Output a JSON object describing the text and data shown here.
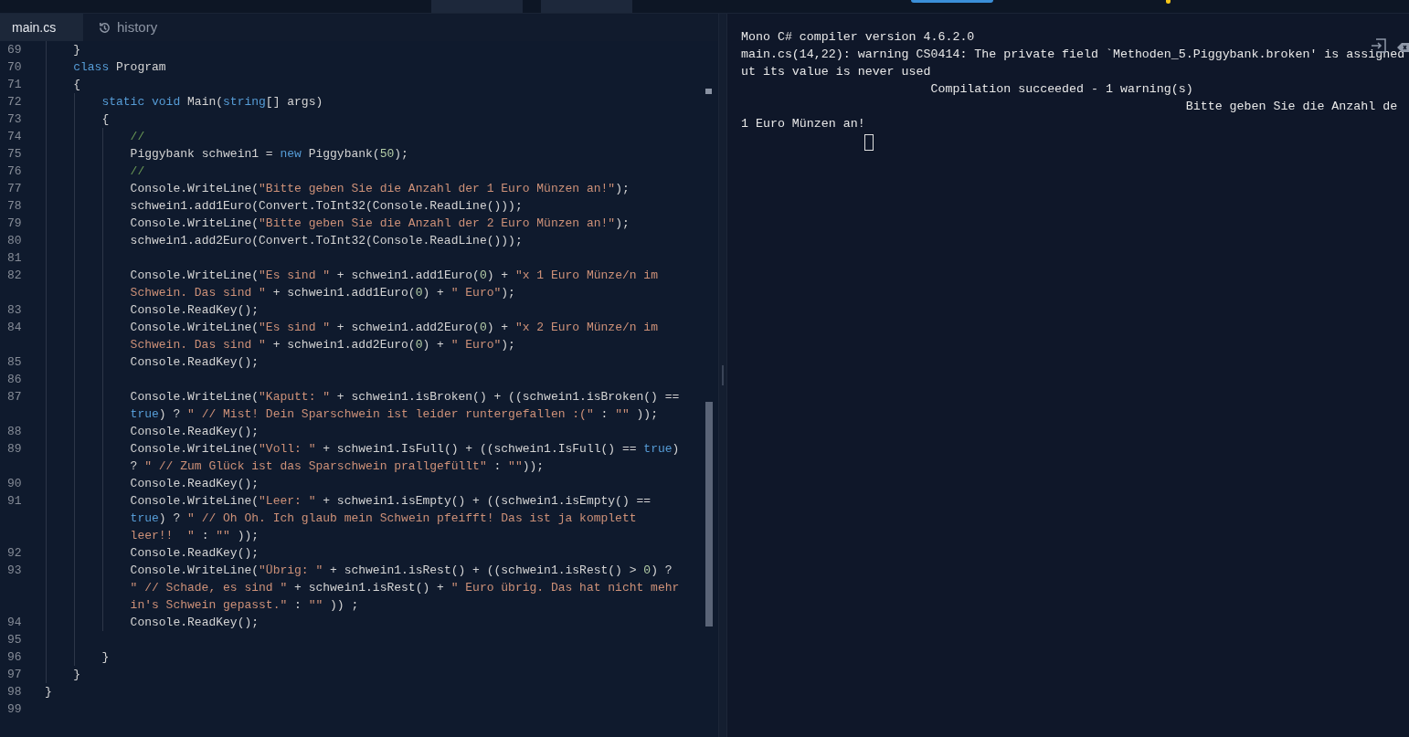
{
  "tabs": [
    {
      "kind": "file",
      "label": "main.cs",
      "selected": true
    },
    {
      "kind": "history",
      "label": "history",
      "selected": false
    }
  ],
  "code_lines": [
    {
      "number": "69",
      "rows": [
        {
          "tokens": [
            {
              "kind": "txt",
              "text": "    }"
            }
          ]
        }
      ]
    },
    {
      "number": "70",
      "rows": [
        {
          "tokens": [
            {
              "kind": "kw",
              "text": "    class"
            },
            {
              "kind": "txt",
              "text": " Program"
            }
          ]
        }
      ]
    },
    {
      "number": "71",
      "rows": [
        {
          "tokens": [
            {
              "kind": "txt",
              "text": "    {"
            }
          ]
        }
      ]
    },
    {
      "number": "72",
      "rows": [
        {
          "tokens": [
            {
              "kind": "kw",
              "text": "        static void"
            },
            {
              "kind": "txt",
              "text": " Main("
            },
            {
              "kind": "kw",
              "text": "string"
            },
            {
              "kind": "txt",
              "text": "[] args)"
            }
          ]
        }
      ]
    },
    {
      "number": "73",
      "rows": [
        {
          "tokens": [
            {
              "kind": "txt",
              "text": "        {"
            }
          ]
        }
      ]
    },
    {
      "number": "74",
      "rows": [
        {
          "tokens": [
            {
              "kind": "cmt",
              "text": "            //"
            }
          ]
        }
      ]
    },
    {
      "number": "75",
      "rows": [
        {
          "tokens": [
            {
              "kind": "txt",
              "text": "            Piggybank schwein1 = "
            },
            {
              "kind": "kw",
              "text": "new"
            },
            {
              "kind": "txt",
              "text": " Piggybank("
            },
            {
              "kind": "num",
              "text": "50"
            },
            {
              "kind": "txt",
              "text": ");"
            }
          ]
        }
      ]
    },
    {
      "number": "76",
      "rows": [
        {
          "tokens": [
            {
              "kind": "cmt",
              "text": "            //"
            }
          ]
        }
      ]
    },
    {
      "number": "77",
      "rows": [
        {
          "tokens": [
            {
              "kind": "txt",
              "text": "            Console.WriteLine("
            },
            {
              "kind": "str",
              "text": "\"Bitte geben Sie die Anzahl der 1 Euro Münzen an!\""
            },
            {
              "kind": "txt",
              "text": ");"
            }
          ]
        }
      ]
    },
    {
      "number": "78",
      "rows": [
        {
          "tokens": [
            {
              "kind": "txt",
              "text": "            schwein1.add1Euro(Convert.ToInt32(Console.ReadLine()));"
            }
          ]
        }
      ]
    },
    {
      "number": "79",
      "rows": [
        {
          "tokens": [
            {
              "kind": "txt",
              "text": "            Console.WriteLine("
            },
            {
              "kind": "str",
              "text": "\"Bitte geben Sie die Anzahl der 2 Euro Münzen an!\""
            },
            {
              "kind": "txt",
              "text": ");"
            }
          ]
        }
      ]
    },
    {
      "number": "80",
      "rows": [
        {
          "tokens": [
            {
              "kind": "txt",
              "text": "            schwein1.add2Euro(Convert.ToInt32(Console.ReadLine()));"
            }
          ]
        }
      ]
    },
    {
      "number": "81"
    },
    {
      "number": "82",
      "rows": [
        {
          "tokens": [
            {
              "kind": "txt",
              "text": "            Console.WriteLine("
            },
            {
              "kind": "str",
              "text": "\"Es sind \""
            },
            {
              "kind": "txt",
              "text": " + schwein1.add1Euro("
            },
            {
              "kind": "num",
              "text": "0"
            },
            {
              "kind": "txt",
              "text": ") + "
            },
            {
              "kind": "str",
              "text": "\"x 1 Euro Münze/n im"
            }
          ]
        },
        {
          "tokens": [
            {
              "kind": "str",
              "text": "Schwein. Das sind \""
            },
            {
              "kind": "txt",
              "text": " + schwein1.add1Euro("
            },
            {
              "kind": "num",
              "text": "0"
            },
            {
              "kind": "txt",
              "text": ") + "
            },
            {
              "kind": "str",
              "text": "\" Euro\""
            },
            {
              "kind": "txt",
              "text": ");"
            }
          ]
        }
      ]
    },
    {
      "number": "83",
      "rows": [
        {
          "tokens": [
            {
              "kind": "txt",
              "text": "            Console.ReadKey();"
            }
          ]
        }
      ]
    },
    {
      "number": "84",
      "rows": [
        {
          "tokens": [
            {
              "kind": "txt",
              "text": "            Console.WriteLine("
            },
            {
              "kind": "str",
              "text": "\"Es sind \""
            },
            {
              "kind": "txt",
              "text": " + schwein1.add2Euro("
            },
            {
              "kind": "num",
              "text": "0"
            },
            {
              "kind": "txt",
              "text": ") + "
            },
            {
              "kind": "str",
              "text": "\"x 2 Euro Münze/n im"
            }
          ]
        },
        {
          "tokens": [
            {
              "kind": "str",
              "text": "Schwein. Das sind \""
            },
            {
              "kind": "txt",
              "text": " + schwein1.add2Euro("
            },
            {
              "kind": "num",
              "text": "0"
            },
            {
              "kind": "txt",
              "text": ") + "
            },
            {
              "kind": "str",
              "text": "\" Euro\""
            },
            {
              "kind": "txt",
              "text": ");"
            }
          ]
        }
      ]
    },
    {
      "number": "85",
      "rows": [
        {
          "tokens": [
            {
              "kind": "txt",
              "text": "            Console.ReadKey();"
            }
          ]
        }
      ]
    },
    {
      "number": "86"
    },
    {
      "number": "87",
      "rows": [
        {
          "tokens": [
            {
              "kind": "txt",
              "text": "            Console.WriteLine("
            },
            {
              "kind": "str",
              "text": "\"Kaputt: \""
            },
            {
              "kind": "txt",
              "text": " + schwein1.isBroken() + ((schwein1.isBroken() =="
            }
          ]
        },
        {
          "tokens": [
            {
              "kind": "kw",
              "text": "true"
            },
            {
              "kind": "txt",
              "text": ") ? "
            },
            {
              "kind": "str",
              "text": "\" // Mist! Dein Sparschwein ist leider runtergefallen :(\""
            },
            {
              "kind": "txt",
              "text": " : "
            },
            {
              "kind": "str",
              "text": "\"\""
            },
            {
              "kind": "txt",
              "text": " ));"
            }
          ]
        }
      ]
    },
    {
      "number": "88",
      "rows": [
        {
          "tokens": [
            {
              "kind": "txt",
              "text": "            Console.ReadKey();"
            }
          ]
        }
      ]
    },
    {
      "number": "89",
      "rows": [
        {
          "tokens": [
            {
              "kind": "txt",
              "text": "            Console.WriteLine("
            },
            {
              "kind": "str",
              "text": "\"Voll: \""
            },
            {
              "kind": "txt",
              "text": " + schwein1.IsFull() + ((schwein1.IsFull() == "
            },
            {
              "kind": "kw",
              "text": "true"
            },
            {
              "kind": "txt",
              "text": ")"
            }
          ]
        },
        {
          "tokens": [
            {
              "kind": "txt",
              "text": "? "
            },
            {
              "kind": "str",
              "text": "\" // Zum Glück ist das Sparschwein prallgefüllt\""
            },
            {
              "kind": "txt",
              "text": " : "
            },
            {
              "kind": "str",
              "text": "\"\""
            },
            {
              "kind": "txt",
              "text": "));"
            }
          ]
        }
      ]
    },
    {
      "number": "90",
      "rows": [
        {
          "tokens": [
            {
              "kind": "txt",
              "text": "            Console.ReadKey();"
            }
          ]
        }
      ]
    },
    {
      "number": "91",
      "rows": [
        {
          "tokens": [
            {
              "kind": "txt",
              "text": "            Console.WriteLine("
            },
            {
              "kind": "str",
              "text": "\"Leer: \""
            },
            {
              "kind": "txt",
              "text": " + schwein1.isEmpty() + ((schwein1.isEmpty() =="
            }
          ]
        },
        {
          "tokens": [
            {
              "kind": "kw",
              "text": "true"
            },
            {
              "kind": "txt",
              "text": ") ? "
            },
            {
              "kind": "str",
              "text": "\" // Oh Oh. Ich glaub mein Schwein pfeifft! Das ist ja komplett"
            }
          ]
        },
        {
          "tokens": [
            {
              "kind": "str",
              "text": "leer!!  \""
            },
            {
              "kind": "txt",
              "text": " : "
            },
            {
              "kind": "str",
              "text": "\"\""
            },
            {
              "kind": "txt",
              "text": " ));"
            }
          ]
        }
      ]
    },
    {
      "number": "92",
      "rows": [
        {
          "tokens": [
            {
              "kind": "txt",
              "text": "            Console.ReadKey();"
            }
          ]
        }
      ]
    },
    {
      "number": "93",
      "rows": [
        {
          "tokens": [
            {
              "kind": "txt",
              "text": "            Console.WriteLine("
            },
            {
              "kind": "str",
              "text": "\"Übrig: \""
            },
            {
              "kind": "txt",
              "text": " + schwein1.isRest() + ((schwein1.isRest() > "
            },
            {
              "kind": "num",
              "text": "0"
            },
            {
              "kind": "txt",
              "text": ") ?"
            }
          ]
        },
        {
          "tokens": [
            {
              "kind": "str",
              "text": "\" // Schade, es sind \""
            },
            {
              "kind": "txt",
              "text": " + schwein1.isRest() + "
            },
            {
              "kind": "str",
              "text": "\" Euro übrig. Das hat nicht mehr"
            }
          ]
        },
        {
          "tokens": [
            {
              "kind": "str",
              "text": "in's Schwein gepasst.\""
            },
            {
              "kind": "txt",
              "text": " : "
            },
            {
              "kind": "str",
              "text": "\"\""
            },
            {
              "kind": "txt",
              "text": " )) ;"
            }
          ]
        }
      ]
    },
    {
      "number": "94",
      "rows": [
        {
          "tokens": [
            {
              "kind": "txt",
              "text": "            Console.ReadKey();"
            }
          ]
        }
      ]
    },
    {
      "number": "95"
    },
    {
      "number": "96",
      "rows": [
        {
          "tokens": [
            {
              "kind": "txt",
              "text": "        }"
            }
          ]
        }
      ]
    },
    {
      "number": "97",
      "rows": [
        {
          "tokens": [
            {
              "kind": "txt",
              "text": "    }"
            }
          ]
        }
      ]
    },
    {
      "number": "98",
      "rows": [
        {
          "tokens": [
            {
              "kind": "txt",
              "text": "}"
            }
          ]
        }
      ]
    },
    {
      "number": "99"
    }
  ],
  "console_lines": [
    "Mono C# compiler version 4.6.2.0",
    "main.cs(14,22): warning CS0414: The private field `Methoden_5.Piggybank.broken' is assigned",
    "ut its value is never used",
    "                          Compilation succeeded - 1 warning(s)",
    "                                                             Bitte geben Sie die Anzahl de",
    "1 Euro Münzen an!"
  ]
}
